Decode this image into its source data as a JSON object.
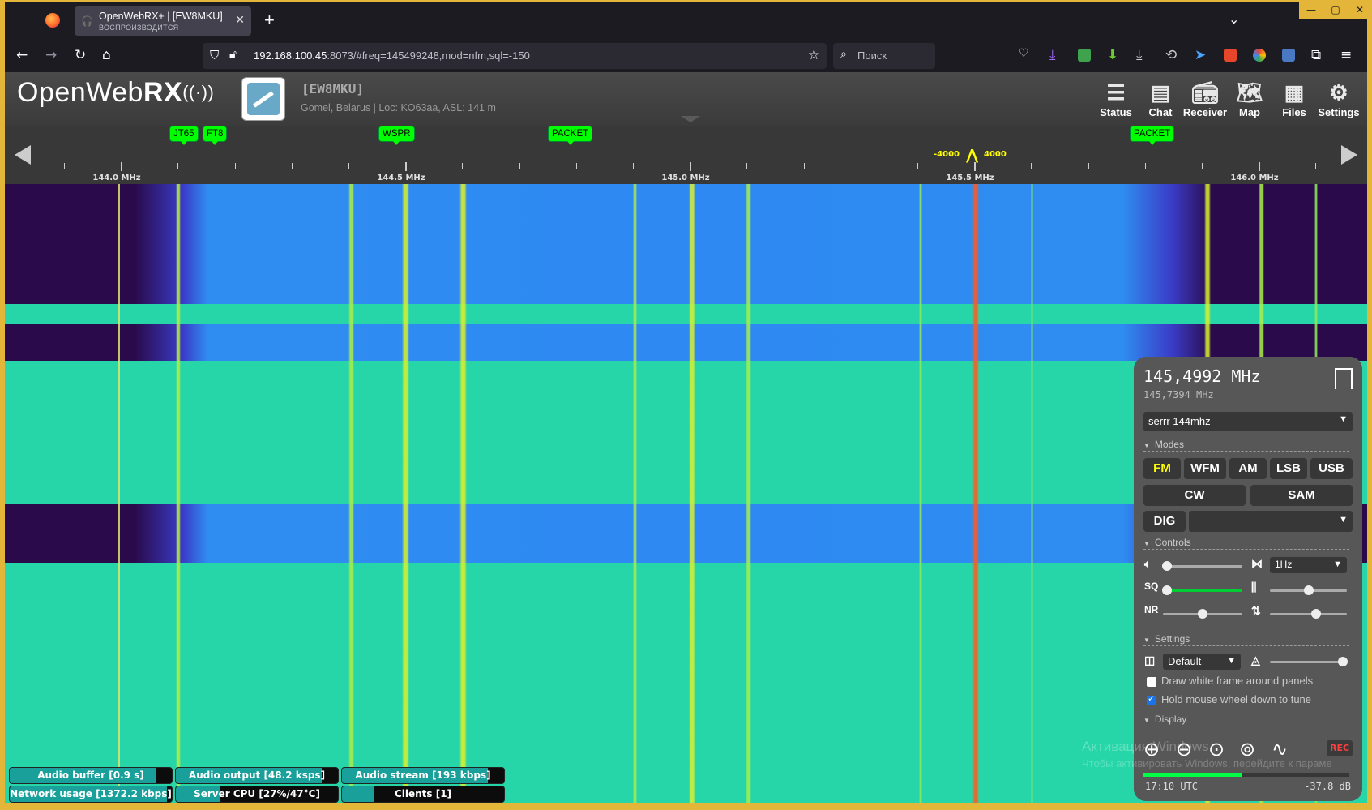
{
  "browser": {
    "tab_title": "OpenWebRX+ | [EW8MKU]",
    "tab_subtitle": "ВОСПРОИЗВОДИТСЯ",
    "url_host": "192.168.100.45",
    "url_rest": ":8073/#freq=145499248,mod=nfm,sql=-150",
    "search_placeholder": "Поиск"
  },
  "header": {
    "logo_a": "OpenWeb",
    "logo_b": "RX",
    "logo_c": "((·))",
    "callsign": "[EW8MKU]",
    "location": "Gomel, Belarus | Loc: KO63aa, ASL: 141 m",
    "buttons": [
      {
        "label": "Status",
        "icon": "status-icon"
      },
      {
        "label": "Chat",
        "icon": "chat-icon"
      },
      {
        "label": "Receiver",
        "icon": "receiver-icon"
      },
      {
        "label": "Map",
        "icon": "map-icon"
      },
      {
        "label": "Files",
        "icon": "files-icon"
      },
      {
        "label": "Settings",
        "icon": "gear-icon"
      }
    ]
  },
  "scale": {
    "bookmarks": [
      "JT65",
      "FT8",
      "WSPR",
      "PACKET",
      "PACKET"
    ],
    "labels": [
      "144.0 MHz",
      "144.5 MHz",
      "145.0 MHz",
      "145.5 MHz",
      "146.0 MHz"
    ],
    "passband_low": "-4000",
    "passband_high": "4000"
  },
  "receiver": {
    "frequency": "145,4992 MHz",
    "sub_frequency": "145,7394 MHz",
    "profile": "serrr 144mhz",
    "sections": {
      "modes": "Modes",
      "controls": "Controls",
      "settings": "Settings",
      "display": "Display"
    },
    "modes_row1": [
      "FM",
      "WFM",
      "AM",
      "LSB",
      "USB"
    ],
    "modes_row2": [
      "CW",
      "SAM"
    ],
    "dig_label": "DIG",
    "dig_value": "",
    "active_mode": "FM",
    "squelch_label": "SQ",
    "nr_label": "NR",
    "step": "1Hz",
    "theme": "Default",
    "draw_frame_label": "Draw white frame around panels",
    "draw_frame_checked": false,
    "hold_wheel_label": "Hold mouse wheel down to tune",
    "hold_wheel_checked": true,
    "rec_label": "REC",
    "utc": "17:10 UTC",
    "db": "-37.8 dB",
    "volume_level": 0.05,
    "squelch_level": 0.05,
    "nr_level": 0.5,
    "wf_min_level": 0.5,
    "wf_max_level": 0.6,
    "contrast_level": 0.95,
    "smeter_level": 0.48
  },
  "windows_watermark": {
    "line1": "Активация Windows",
    "line2": "Чтобы активировать Windows, перейдите к параме"
  },
  "stats": {
    "audio_buffer": "Audio buffer [0.9 s]",
    "audio_output": "Audio output [48.2 ksps]",
    "audio_stream": "Audio stream [193 kbps]",
    "network_usage": "Network usage [1372.2 kbps]",
    "server_cpu": "Server CPU [27%/47°C]",
    "clients": "Clients [1]",
    "audio_buffer_fill": 0.9,
    "audio_output_fill": 0.9,
    "audio_stream_fill": 0.9,
    "network_usage_fill": 0.97,
    "server_cpu_fill": 0.27,
    "clients_fill": 0.2
  },
  "colors": {
    "waterfall_bg": "#26d6a8",
    "bookmark": "#00ff00",
    "accent_yellow": "#ffff00"
  }
}
